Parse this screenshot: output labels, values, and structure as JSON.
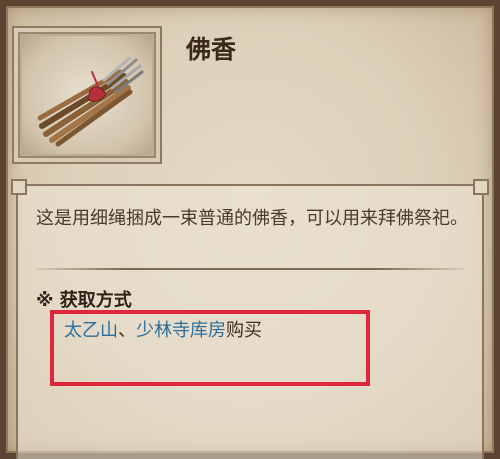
{
  "item": {
    "name": "佛香",
    "icon": "incense-sticks-icon",
    "description": "这是用细绳捆成一束普通的佛香，可以用来拜佛祭祀。"
  },
  "acquire": {
    "heading": "※ 获取方式",
    "sources": [
      {
        "text": "太乙山",
        "link": true
      },
      {
        "text": "、",
        "link": false
      },
      {
        "text": "少林寺库房",
        "link": true
      },
      {
        "text": "购买",
        "link": false
      }
    ]
  },
  "colors": {
    "link": "#2b6f9c",
    "highlight": "#e0263c",
    "frame": "#5a4532"
  }
}
